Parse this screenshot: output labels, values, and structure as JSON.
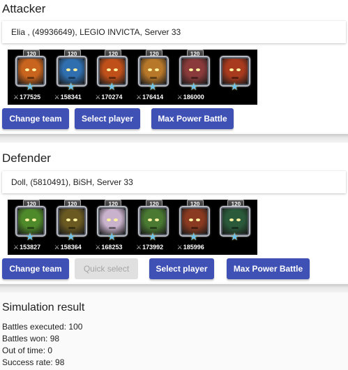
{
  "attacker": {
    "title": "Attacker",
    "player": "Elia , (49936649), LEGIO INVICTA, Server 33",
    "heroes": [
      {
        "level": "120",
        "power": "177525",
        "color": "#c8641e",
        "icon": "hero-portrait-icon"
      },
      {
        "level": "120",
        "power": "158341",
        "color": "#2f6fb0",
        "icon": "hero-portrait-icon"
      },
      {
        "level": "120",
        "power": "170274",
        "color": "#c0501a",
        "icon": "hero-portrait-icon"
      },
      {
        "level": "120",
        "power": "176414",
        "color": "#b8782a",
        "icon": "hero-portrait-icon"
      },
      {
        "level": "120",
        "power": "186000",
        "color": "#8a3a3a",
        "icon": "hero-portrait-icon"
      },
      {
        "level": "",
        "power": "",
        "color": "#a83a1e",
        "icon": "hero-portrait-icon"
      }
    ],
    "buttons": {
      "change_team": "Change team",
      "select_player": "Select player",
      "max_power": "Max Power Battle"
    }
  },
  "defender": {
    "title": "Defender",
    "player": "Doll, (5810491), BiSH, Server 33",
    "heroes": [
      {
        "level": "120",
        "power": "153827",
        "color": "#4f8a2a",
        "icon": "hero-portrait-icon"
      },
      {
        "level": "120",
        "power": "158364",
        "color": "#6a5a22",
        "icon": "hero-portrait-icon"
      },
      {
        "level": "120",
        "power": "168253",
        "color": "#c9b2cc",
        "icon": "hero-portrait-icon"
      },
      {
        "level": "120",
        "power": "173992",
        "color": "#4a7a32",
        "icon": "hero-portrait-icon"
      },
      {
        "level": "120",
        "power": "185996",
        "color": "#8a3a20",
        "icon": "hero-portrait-icon"
      },
      {
        "level": "120",
        "power": "",
        "color": "#2a5a3a",
        "icon": "hero-portrait-icon"
      }
    ],
    "buttons": {
      "change_team": "Change team",
      "quick_select": "Quick select",
      "select_player": "Select player",
      "max_power": "Max Power Battle"
    }
  },
  "result": {
    "title": "Simulation result",
    "lines": [
      "Battles executed: 100",
      "Battles won: 98",
      "Out of time: 0",
      "Success rate: 98"
    ]
  },
  "colors": {
    "primary": "#3f51b5",
    "disabled_bg": "#e0e0e0",
    "disabled_text": "#a5a5a5",
    "star": "#6fc4ee"
  }
}
